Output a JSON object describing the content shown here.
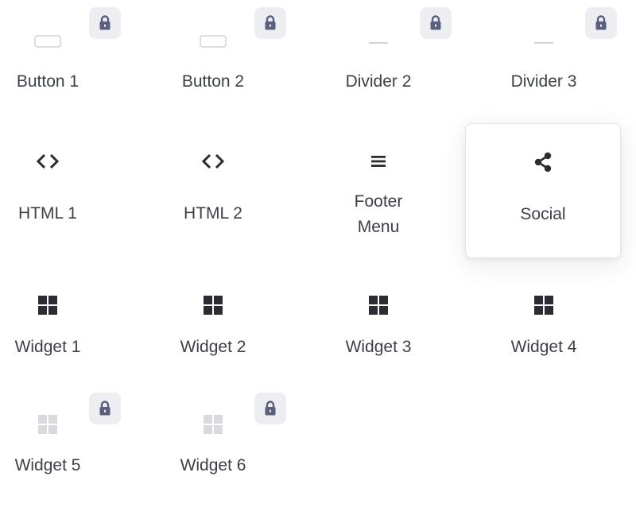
{
  "colors": {
    "icon_dark": "#2b2d33",
    "icon_disabled": "#d2d4d9",
    "lock_icon": "#5a5f7d",
    "lock_badge_bg": "#eceef2",
    "label": "#3c3f48",
    "active_border": "#e3e4e8"
  },
  "widgets": [
    {
      "label": "Button 1",
      "icon": "button-outline-icon",
      "locked": true,
      "disabled": true
    },
    {
      "label": "Button 2",
      "icon": "button-outline-icon",
      "locked": true,
      "disabled": true
    },
    {
      "label": "Divider 2",
      "icon": "divider-line-icon",
      "locked": true,
      "disabled": true
    },
    {
      "label": "Divider 3",
      "icon": "divider-line-icon",
      "locked": true,
      "disabled": true
    },
    {
      "label": "HTML 1",
      "icon": "code-brackets-icon",
      "locked": false,
      "disabled": false
    },
    {
      "label": "HTML 2",
      "icon": "code-brackets-icon",
      "locked": false,
      "disabled": false
    },
    {
      "label": "Footer\nMenu",
      "icon": "hamburger-menu-icon",
      "locked": false,
      "disabled": false
    },
    {
      "label": "Social",
      "icon": "share-icon",
      "locked": false,
      "disabled": false,
      "active": true
    },
    {
      "label": "Widget 1",
      "icon": "widget-grid-icon",
      "locked": false,
      "disabled": false
    },
    {
      "label": "Widget 2",
      "icon": "widget-grid-icon",
      "locked": false,
      "disabled": false
    },
    {
      "label": "Widget 3",
      "icon": "widget-grid-icon",
      "locked": false,
      "disabled": false
    },
    {
      "label": "Widget 4",
      "icon": "widget-grid-icon",
      "locked": false,
      "disabled": false
    },
    {
      "label": "Widget 5",
      "icon": "widget-grid-icon",
      "locked": true,
      "disabled": true
    },
    {
      "label": "Widget 6",
      "icon": "widget-grid-icon",
      "locked": true,
      "disabled": true
    }
  ]
}
